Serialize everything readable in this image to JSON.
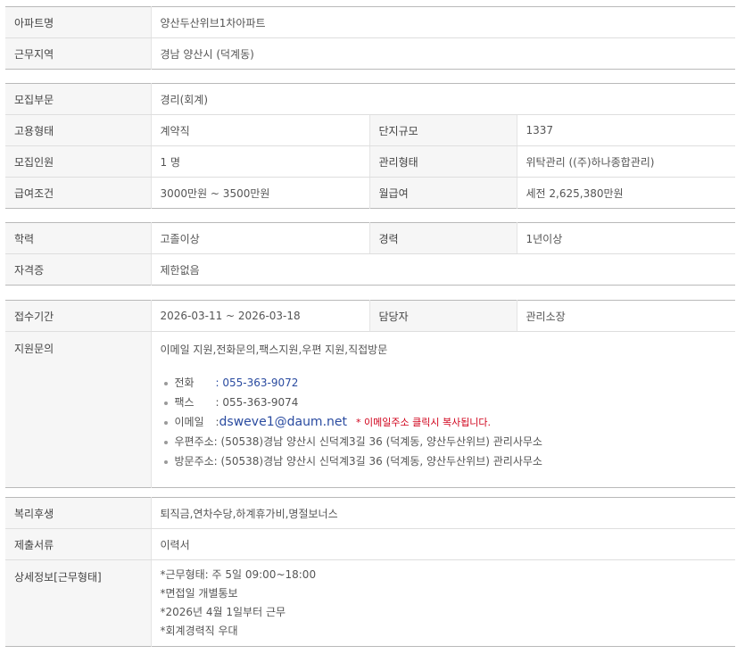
{
  "section1": {
    "apt_label": "아파트명",
    "apt_value": "양산두산위브1차아파트",
    "region_label": "근무지역",
    "region_value": "경남  양산시 (덕계동)"
  },
  "section2": {
    "dept_label": "모집부문",
    "dept_value": "경리(회계)",
    "emp_label": "고용형태",
    "emp_value": "계약직",
    "scale_label": "단지규모",
    "scale_value": "1337",
    "count_label": "모집인원",
    "count_value": "1 명",
    "mgmt_label": "관리형태",
    "mgmt_value": "위탁관리 ((주)하나종합관리)",
    "salary_label": "급여조건",
    "salary_value": "3000만원 ~ 3500만원",
    "monthly_label": "월급여",
    "monthly_value": "세전 2,625,380만원"
  },
  "section3": {
    "edu_label": "학력",
    "edu_value": "고졸이상",
    "exp_label": "경력",
    "exp_value": "1년이상",
    "cert_label": "자격증",
    "cert_value": "제한없음"
  },
  "section4": {
    "period_label": "접수기간",
    "period_value": "2026-03-11 ~ 2026-03-18",
    "manager_label": "담당자",
    "manager_value": "관리소장",
    "inquiry_label": "지원문의",
    "inquiry_intro": "이메일 지원,전화문의,팩스지원,우편 지원,직접방문",
    "phone_label": "전화",
    "phone_value": ": 055-363-9072",
    "fax_label": "팩스",
    "fax_value": ": 055-363-9074",
    "email_label": "이메일",
    "email_colon": ":",
    "email_value": "dsweve1@daum.net",
    "email_note": "* 이메일주소 클릭시 복사됩니다.",
    "post_label": "우편주소",
    "post_value": ": (50538)경남 양산시 신덕계3길 36 (덕계동, 양산두산위브) 관리사무소",
    "visit_label": "방문주소",
    "visit_value": ": (50538)경남 양산시 신덕계3길 36 (덕계동, 양산두산위브) 관리사무소"
  },
  "section5": {
    "welfare_label": "복리후생",
    "welfare_value": "퇴직금,연차수당,하계휴가비,명절보너스",
    "docs_label": "제출서류",
    "docs_value": "이력서",
    "detail_label": "상세정보[근무형태]",
    "detail_lines": [
      "*근무형태: 주 5일 09:00~18:00",
      "*면접일 개별통보",
      "*2026년 4월 1일부터 근무",
      "*회계경력직 우대"
    ]
  }
}
